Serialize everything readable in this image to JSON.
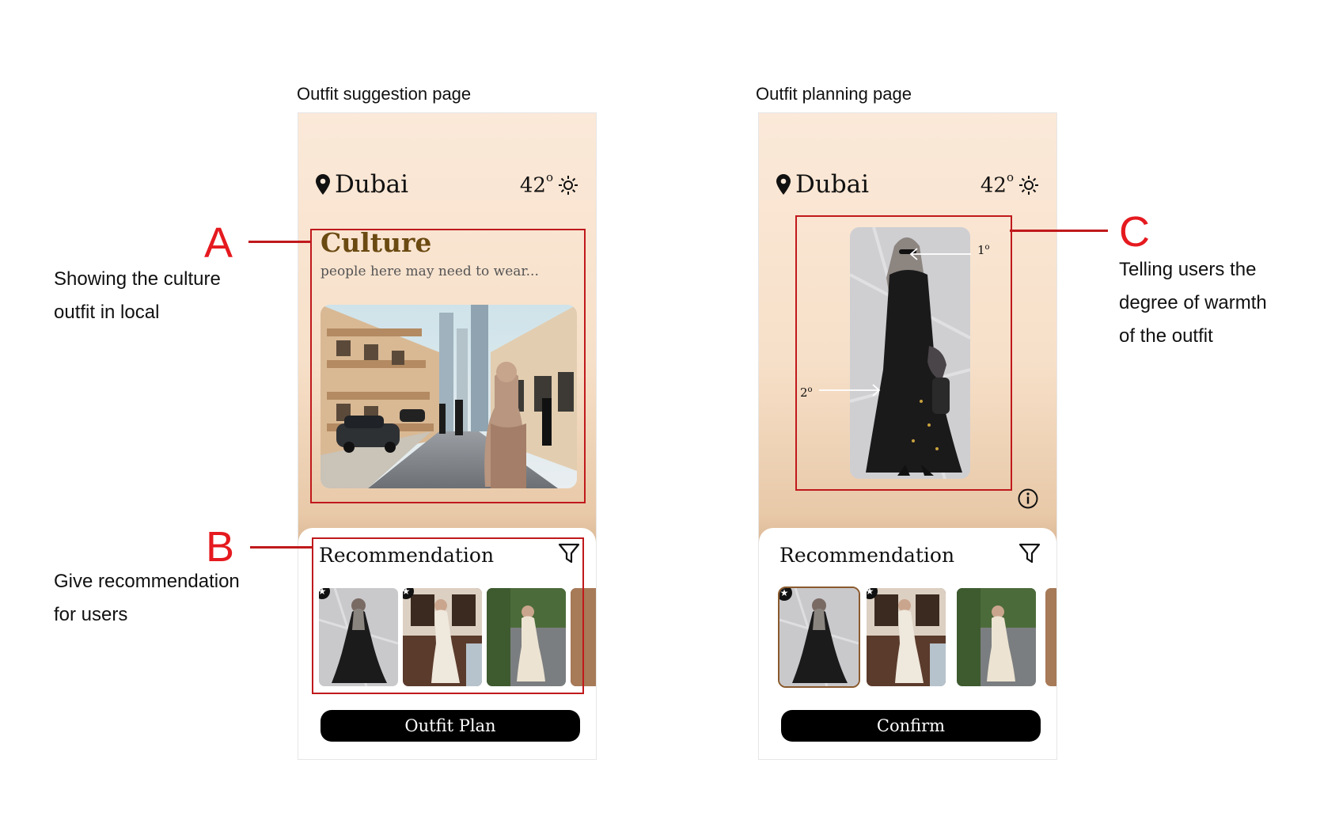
{
  "labels": {
    "left_page": "Outfit suggestion page",
    "right_page": "Outfit planning page"
  },
  "suggestion_page": {
    "city": "Dubai",
    "temp": "42",
    "temp_unit": "o",
    "culture_title": "Culture",
    "culture_subtitle": "people here may need to wear...",
    "rec_title": "Recommendation",
    "button": "Outfit Plan"
  },
  "planning_page": {
    "city": "Dubai",
    "temp": "42",
    "temp_unit": "o",
    "warmth_top": "1",
    "warmth_bottom": "2",
    "warmth_unit": "o",
    "rec_title": "Recommendation",
    "button": "Confirm"
  },
  "annotations": {
    "a_letter": "A",
    "a_text": "Showing the culture\noutfit in local",
    "b_letter": "B",
    "b_text": "Give recommendation\nfor users",
    "c_letter": "C",
    "c_text": "Telling users the\ndegree of warmth\nof the outfit"
  },
  "icons": [
    "location-pin-icon",
    "sun-icon",
    "filter-icon",
    "star-icon",
    "info-icon"
  ],
  "colors": {
    "accent_red": "#c0191c",
    "annotation_letter": "#e51a1f",
    "culture_title": "#6b4a12",
    "selected_border": "#8a5a2e"
  }
}
